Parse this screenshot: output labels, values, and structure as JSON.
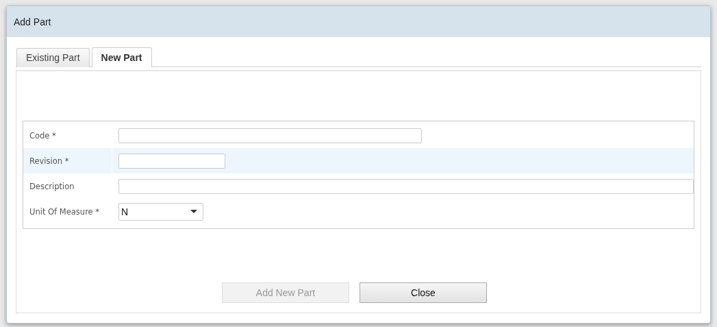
{
  "window": {
    "title": "Add Part"
  },
  "tabs": [
    {
      "label": "Existing Part",
      "selected": false
    },
    {
      "label": "New Part",
      "selected": true
    }
  ],
  "form": {
    "rows": [
      {
        "label": "Code *",
        "kind": "text",
        "highlighted": false
      },
      {
        "label": "Revision *",
        "kind": "text",
        "highlighted": true
      },
      {
        "label": "Description",
        "kind": "text",
        "highlighted": false
      },
      {
        "label": "Unit Of Measure *",
        "kind": "select",
        "value": "N",
        "highlighted": false
      }
    ]
  },
  "buttons": [
    {
      "label": "Add New Part",
      "disabled": true
    },
    {
      "label": "Close",
      "disabled": false
    }
  ]
}
